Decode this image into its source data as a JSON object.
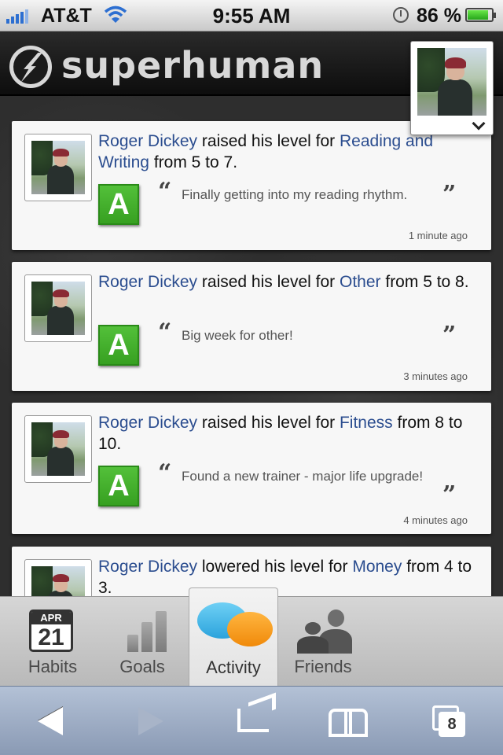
{
  "status_bar": {
    "carrier": "AT&T",
    "time": "9:55 AM",
    "battery_percent": "86 %",
    "battery_level": 0.86
  },
  "header": {
    "logo_text": "superhuman"
  },
  "feed": [
    {
      "user": "Roger Dickey",
      "verb": "raised his level for",
      "category": "Reading and Writing",
      "change": "from 5 to 7.",
      "grade": "A",
      "quote": "Finally getting into my reading rhythm.",
      "time": "1 minute ago"
    },
    {
      "user": "Roger Dickey",
      "verb": "raised his level for",
      "category": "Other",
      "change": "from 5 to 8.",
      "grade": "A",
      "quote": "Big week for other!",
      "time": "3 minutes ago"
    },
    {
      "user": "Roger Dickey",
      "verb": "raised his level for",
      "category": "Fitness",
      "change": "from 8 to 10.",
      "grade": "A",
      "quote": "Found a new trainer - major life upgrade!",
      "time": "4 minutes ago"
    },
    {
      "user": "Roger Dickey",
      "verb": "lowered his level for",
      "category": "Money",
      "change": "from 4 to 3."
    }
  ],
  "tabs": [
    {
      "label": "Habits",
      "icon": "calendar-icon",
      "cal_month": "APR",
      "cal_day": "21"
    },
    {
      "label": "Goals",
      "icon": "bar-chart-icon"
    },
    {
      "label": "Activity",
      "icon": "chat-bubbles-icon",
      "active": true
    },
    {
      "label": "Friends",
      "icon": "people-icon"
    }
  ],
  "browser": {
    "tab_count": "8"
  },
  "colors": {
    "link": "#2b4d8f",
    "grade_green": "#37a021",
    "toolbar_blue": "#8a9ab4"
  }
}
